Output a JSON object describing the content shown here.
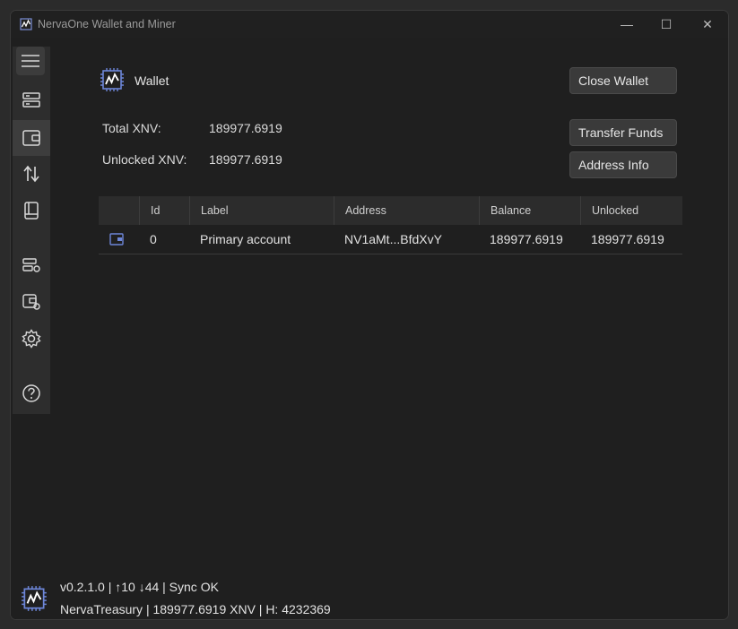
{
  "window": {
    "title": "NervaOne Wallet and Miner",
    "controls": {
      "minimize": "—",
      "maximize": "☐",
      "close": "✕"
    }
  },
  "sidebar": {
    "items": [
      {
        "name": "menu-icon",
        "active": false
      },
      {
        "name": "daemon-icon",
        "active": false
      },
      {
        "name": "wallet-icon",
        "active": true
      },
      {
        "name": "transfers-icon",
        "active": false
      },
      {
        "name": "address-book-icon",
        "active": false
      },
      {
        "name": "daemon-setup-icon",
        "active": false
      },
      {
        "name": "wallet-setup-icon",
        "active": false
      },
      {
        "name": "settings-icon",
        "active": false
      },
      {
        "name": "help-icon",
        "active": false
      }
    ]
  },
  "main": {
    "section_title": "Wallet",
    "total_label": "Total XNV:",
    "total_value": "189977.6919",
    "unlocked_label": "Unlocked XNV:",
    "unlocked_value": "189977.6919",
    "buttons": {
      "close_wallet": "Close Wallet",
      "transfer_funds": "Transfer Funds",
      "address_info": "Address Info"
    },
    "table": {
      "headers": [
        "",
        "Id",
        "Label",
        "Address",
        "Balance",
        "Unlocked"
      ],
      "rows": [
        {
          "id": "0",
          "label": "Primary account",
          "address": "NV1aMt...BfdXvY",
          "balance": "189977.6919",
          "unlocked": "189977.6919"
        }
      ]
    }
  },
  "status": {
    "line1": "v0.2.1.0 | ↑10  ↓44 | Sync OK",
    "line2": "NervaTreasury | 189977.6919 XNV | H: 4232369"
  },
  "colors": {
    "accent": "#5b7fd6",
    "background": "#1f1f1f",
    "rail": "#2d2d2d"
  }
}
